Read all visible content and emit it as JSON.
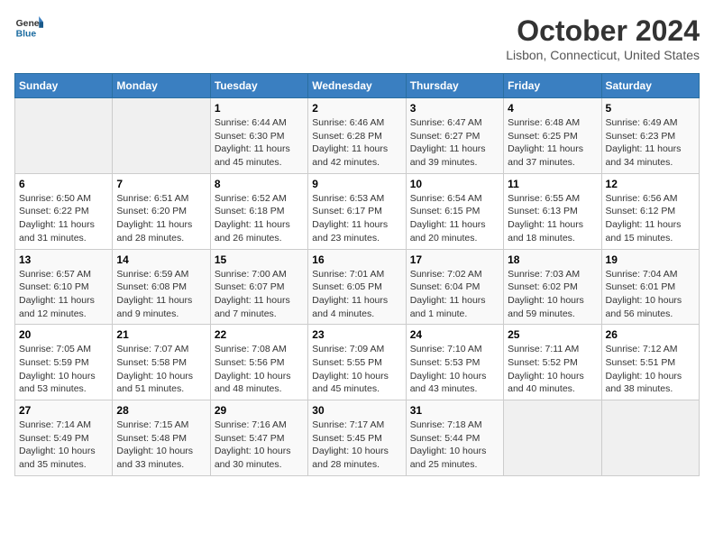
{
  "header": {
    "logo": {
      "text_general": "General",
      "text_blue": "Blue"
    },
    "title": "October 2024",
    "location": "Lisbon, Connecticut, United States"
  },
  "weekdays": [
    "Sunday",
    "Monday",
    "Tuesday",
    "Wednesday",
    "Thursday",
    "Friday",
    "Saturday"
  ],
  "weeks": [
    [
      {
        "day": "",
        "info": ""
      },
      {
        "day": "",
        "info": ""
      },
      {
        "day": "1",
        "sunrise": "6:44 AM",
        "sunset": "6:30 PM",
        "daylight": "11 hours and 45 minutes."
      },
      {
        "day": "2",
        "sunrise": "6:46 AM",
        "sunset": "6:28 PM",
        "daylight": "11 hours and 42 minutes."
      },
      {
        "day": "3",
        "sunrise": "6:47 AM",
        "sunset": "6:27 PM",
        "daylight": "11 hours and 39 minutes."
      },
      {
        "day": "4",
        "sunrise": "6:48 AM",
        "sunset": "6:25 PM",
        "daylight": "11 hours and 37 minutes."
      },
      {
        "day": "5",
        "sunrise": "6:49 AM",
        "sunset": "6:23 PM",
        "daylight": "11 hours and 34 minutes."
      }
    ],
    [
      {
        "day": "6",
        "sunrise": "6:50 AM",
        "sunset": "6:22 PM",
        "daylight": "11 hours and 31 minutes."
      },
      {
        "day": "7",
        "sunrise": "6:51 AM",
        "sunset": "6:20 PM",
        "daylight": "11 hours and 28 minutes."
      },
      {
        "day": "8",
        "sunrise": "6:52 AM",
        "sunset": "6:18 PM",
        "daylight": "11 hours and 26 minutes."
      },
      {
        "day": "9",
        "sunrise": "6:53 AM",
        "sunset": "6:17 PM",
        "daylight": "11 hours and 23 minutes."
      },
      {
        "day": "10",
        "sunrise": "6:54 AM",
        "sunset": "6:15 PM",
        "daylight": "11 hours and 20 minutes."
      },
      {
        "day": "11",
        "sunrise": "6:55 AM",
        "sunset": "6:13 PM",
        "daylight": "11 hours and 18 minutes."
      },
      {
        "day": "12",
        "sunrise": "6:56 AM",
        "sunset": "6:12 PM",
        "daylight": "11 hours and 15 minutes."
      }
    ],
    [
      {
        "day": "13",
        "sunrise": "6:57 AM",
        "sunset": "6:10 PM",
        "daylight": "11 hours and 12 minutes."
      },
      {
        "day": "14",
        "sunrise": "6:59 AM",
        "sunset": "6:08 PM",
        "daylight": "11 hours and 9 minutes."
      },
      {
        "day": "15",
        "sunrise": "7:00 AM",
        "sunset": "6:07 PM",
        "daylight": "11 hours and 7 minutes."
      },
      {
        "day": "16",
        "sunrise": "7:01 AM",
        "sunset": "6:05 PM",
        "daylight": "11 hours and 4 minutes."
      },
      {
        "day": "17",
        "sunrise": "7:02 AM",
        "sunset": "6:04 PM",
        "daylight": "11 hours and 1 minute."
      },
      {
        "day": "18",
        "sunrise": "7:03 AM",
        "sunset": "6:02 PM",
        "daylight": "10 hours and 59 minutes."
      },
      {
        "day": "19",
        "sunrise": "7:04 AM",
        "sunset": "6:01 PM",
        "daylight": "10 hours and 56 minutes."
      }
    ],
    [
      {
        "day": "20",
        "sunrise": "7:05 AM",
        "sunset": "5:59 PM",
        "daylight": "10 hours and 53 minutes."
      },
      {
        "day": "21",
        "sunrise": "7:07 AM",
        "sunset": "5:58 PM",
        "daylight": "10 hours and 51 minutes."
      },
      {
        "day": "22",
        "sunrise": "7:08 AM",
        "sunset": "5:56 PM",
        "daylight": "10 hours and 48 minutes."
      },
      {
        "day": "23",
        "sunrise": "7:09 AM",
        "sunset": "5:55 PM",
        "daylight": "10 hours and 45 minutes."
      },
      {
        "day": "24",
        "sunrise": "7:10 AM",
        "sunset": "5:53 PM",
        "daylight": "10 hours and 43 minutes."
      },
      {
        "day": "25",
        "sunrise": "7:11 AM",
        "sunset": "5:52 PM",
        "daylight": "10 hours and 40 minutes."
      },
      {
        "day": "26",
        "sunrise": "7:12 AM",
        "sunset": "5:51 PM",
        "daylight": "10 hours and 38 minutes."
      }
    ],
    [
      {
        "day": "27",
        "sunrise": "7:14 AM",
        "sunset": "5:49 PM",
        "daylight": "10 hours and 35 minutes."
      },
      {
        "day": "28",
        "sunrise": "7:15 AM",
        "sunset": "5:48 PM",
        "daylight": "10 hours and 33 minutes."
      },
      {
        "day": "29",
        "sunrise": "7:16 AM",
        "sunset": "5:47 PM",
        "daylight": "10 hours and 30 minutes."
      },
      {
        "day": "30",
        "sunrise": "7:17 AM",
        "sunset": "5:45 PM",
        "daylight": "10 hours and 28 minutes."
      },
      {
        "day": "31",
        "sunrise": "7:18 AM",
        "sunset": "5:44 PM",
        "daylight": "10 hours and 25 minutes."
      },
      {
        "day": "",
        "info": ""
      },
      {
        "day": "",
        "info": ""
      }
    ]
  ]
}
